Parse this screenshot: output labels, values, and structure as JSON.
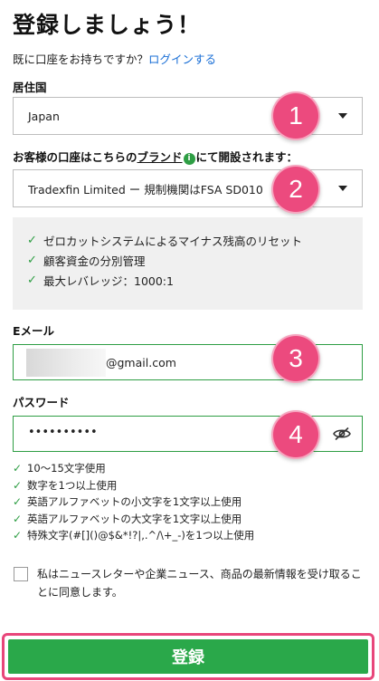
{
  "header": {
    "title": "登録しましょう！",
    "login_prompt": "既に口座をお持ちですか？",
    "login_link": "ログインする"
  },
  "residence": {
    "label": "居住国",
    "value": "Japan"
  },
  "brand": {
    "label_prefix": "お客様の口座はこちらの",
    "label_link": "ブランド",
    "label_info": "i",
    "label_suffix": "にて開設されます：",
    "value": "Tradexfin Limited ー 規制機関はFSA SD010"
  },
  "features": [
    "ゼロカットシステムによるマイナス残高のリセット",
    "顧客資金の分別管理",
    "最大レバレッジ：1000:1"
  ],
  "email": {
    "label": "Eメール",
    "value_suffix": "@gmail.com"
  },
  "password": {
    "label": "パスワード",
    "value": "••••••••••",
    "toggle_icon": "eye-off-icon"
  },
  "password_rules": [
    "10〜15文字使用",
    "数字を1つ以上使用",
    "英語アルファベットの小文字を1文字以上使用",
    "英語アルファベットの大文字を1文字以上使用",
    "特殊文字(#[]()@$&*!?|,.^/\\+_-)を1つ以上使用"
  ],
  "consent": {
    "text": "私はニュースレターや企業ニュース、商品の最新情報を受け取ることに同意します。"
  },
  "submit": {
    "label": "登録"
  },
  "steps": [
    "1",
    "2",
    "3",
    "4"
  ],
  "colors": {
    "accent_green": "#2aa84a",
    "check_green": "#2e9e44",
    "link_blue": "#1a6fd6",
    "step_pink": "#ec4a7e"
  }
}
